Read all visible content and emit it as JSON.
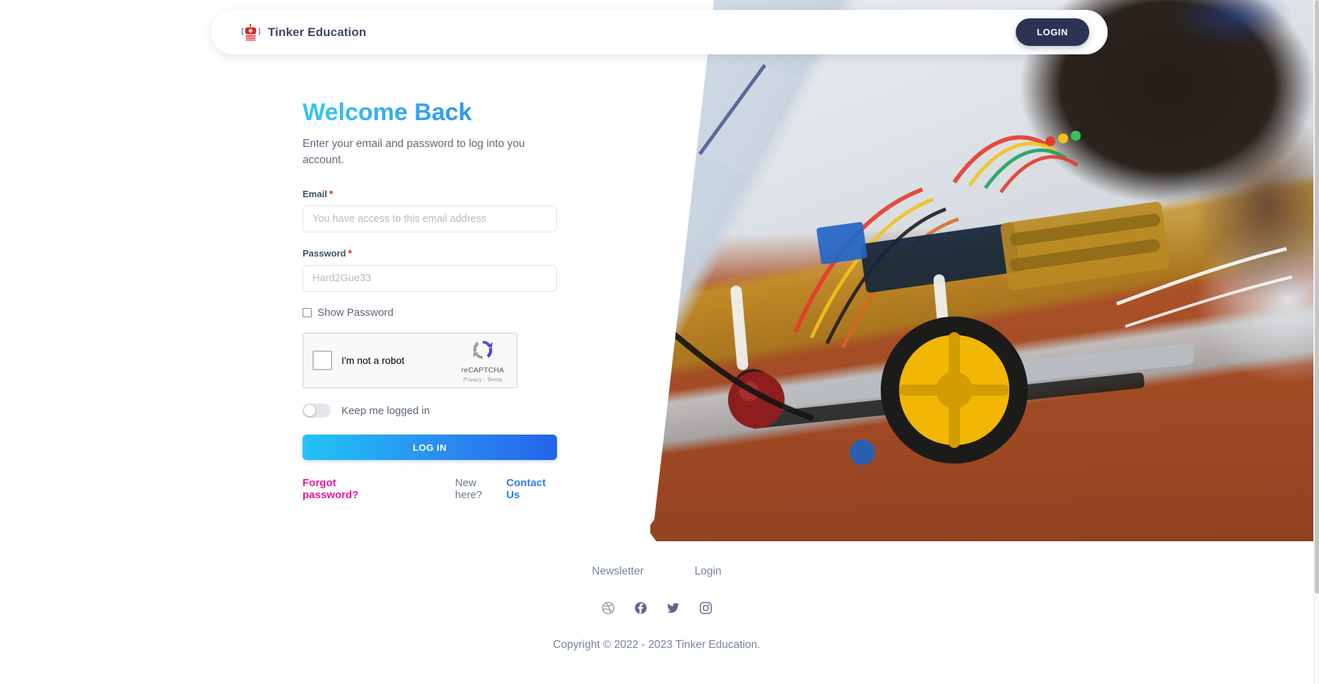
{
  "header": {
    "brand_name": "Tinker Education",
    "brand_logo_icon": "robot-logo-icon",
    "login_button_label": "LOGIN"
  },
  "hero": {
    "image_alt": "student-with-robot-car-photo"
  },
  "form": {
    "title": "Welcome Back",
    "subtitle": "Enter your email and password to log into you account.",
    "email": {
      "label": "Email",
      "required_mark": "*",
      "value": "",
      "placeholder": "You have access to this email address"
    },
    "password": {
      "label": "Password",
      "required_mark": "*",
      "value": "",
      "placeholder": "Hard2Gue33"
    },
    "show_password_label": "Show Password",
    "show_password_checked": false,
    "recaptcha": {
      "checkbox_label": "I'm not a robot",
      "brand": "reCAPTCHA",
      "legal": "Privacy - Terms",
      "logo_icon": "recaptcha-logo-icon",
      "checked": false
    },
    "keep_logged_in_label": "Keep me logged in",
    "keep_logged_in_on": false,
    "submit_label": "LOG IN",
    "forgot_password_label": "Forgot password?",
    "new_here_text": "New here?",
    "contact_us_label": "Contact Us"
  },
  "footer": {
    "links": [
      {
        "label": "Newsletter"
      },
      {
        "label": "Login"
      }
    ],
    "social": [
      {
        "name": "dribbble-icon"
      },
      {
        "name": "facebook-icon"
      },
      {
        "name": "twitter-icon"
      },
      {
        "name": "instagram-icon"
      }
    ],
    "copyright": "Copyright © 2022 - 2023 Tinker Education."
  },
  "colors": {
    "accent_cyan": "#22c4f5",
    "accent_blue": "#2563eb",
    "brand_navy": "#2e3356",
    "magenta": "#e3199c",
    "required_red": "#e0242e",
    "muted_text": "#7784a0"
  }
}
